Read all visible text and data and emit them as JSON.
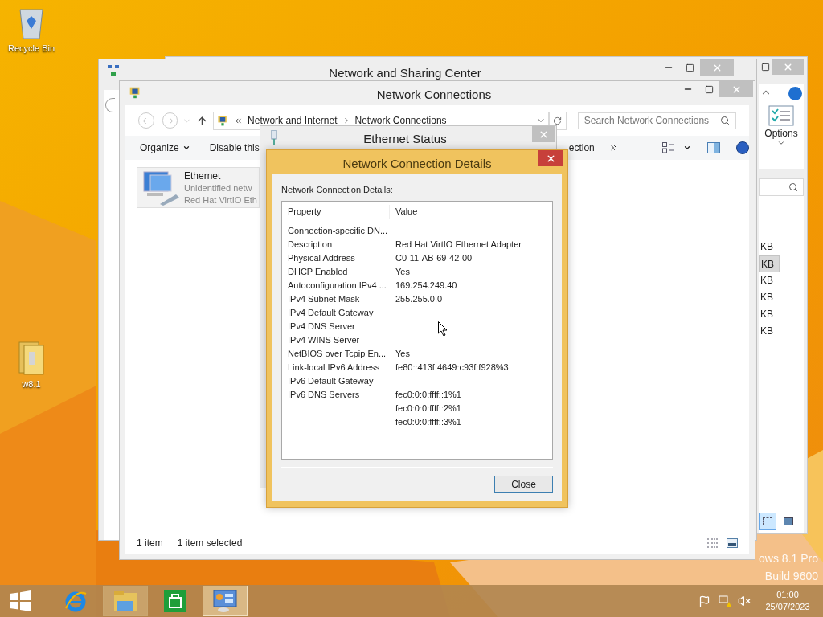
{
  "desktop_icons": [
    {
      "kind": "recycle-bin",
      "label": "Recycle Bin"
    },
    {
      "kind": "folder",
      "label": "w8.1"
    }
  ],
  "edition_text": [
    "ows 8.1 Pro",
    "Build 9600"
  ],
  "back_window": {
    "options_label": "Options",
    "rows": [
      {
        "size": "KB",
        "selected": false
      },
      {
        "size": "KB",
        "selected": true
      },
      {
        "size": "KB",
        "selected": false
      },
      {
        "size": "KB",
        "selected": false
      },
      {
        "size": "KB",
        "selected": false
      },
      {
        "size": "KB",
        "selected": false
      }
    ],
    "view_buttons": [
      {
        "kind": "details",
        "selected": true
      },
      {
        "kind": "preview",
        "selected": false
      }
    ]
  },
  "sharing_center": {
    "title": "Network and Sharing Center"
  },
  "network_connections": {
    "title": "Network Connections",
    "breadcrumb": [
      "Network and Internet",
      "Network Connections"
    ],
    "search": {
      "placeholder": "Search Network Connections"
    },
    "toolbar": [
      "Organize",
      "Disable this",
      "ection"
    ],
    "item": {
      "name": "Ethernet",
      "status": "Unidentified netw",
      "device": "Red Hat VirtIO Eth"
    },
    "status_bar": [
      "1 item",
      "1 item selected"
    ]
  },
  "ethernet_status": {
    "title": "Ethernet Status"
  },
  "details_dialog": {
    "title": "Network Connection Details",
    "label": "Network Connection Details:",
    "columns": [
      "Property",
      "Value"
    ],
    "rows": [
      {
        "property": "Connection-specific DN..."
      },
      {
        "property": "Description",
        "value": "Red Hat VirtIO Ethernet Adapter"
      },
      {
        "property": "Physical Address",
        "value": "C0-11-AB-69-42-00"
      },
      {
        "property": "DHCP Enabled",
        "value": "Yes"
      },
      {
        "property": "Autoconfiguration IPv4 ...",
        "value": "169.254.249.40"
      },
      {
        "property": "IPv4 Subnet Mask",
        "value": "255.255.0.0"
      },
      {
        "property": "IPv4 Default Gateway"
      },
      {
        "property": "IPv4 DNS Server"
      },
      {
        "property": "IPv4 WINS Server"
      },
      {
        "property": "NetBIOS over Tcpip En...",
        "value": "Yes"
      },
      {
        "property": "Link-local IPv6 Address",
        "value": "fe80::413f:4649:c93f:f928%3"
      },
      {
        "property": "IPv6 Default Gateway"
      },
      {
        "property": "IPv6 DNS Servers",
        "value": "fec0:0:0:ffff::1%1"
      },
      {
        "value": "fec0:0:0:ffff::2%1"
      },
      {
        "value": "fec0:0:0:ffff::3%1"
      }
    ],
    "button": "Close"
  },
  "taskbar": {
    "apps": [
      {
        "kind": "browser",
        "selected": false
      },
      {
        "kind": "files",
        "selected": false
      },
      {
        "kind": "store",
        "selected": false
      },
      {
        "kind": "control-panel",
        "selected": true
      }
    ],
    "time": "01:00",
    "date": "25/07/2023"
  }
}
